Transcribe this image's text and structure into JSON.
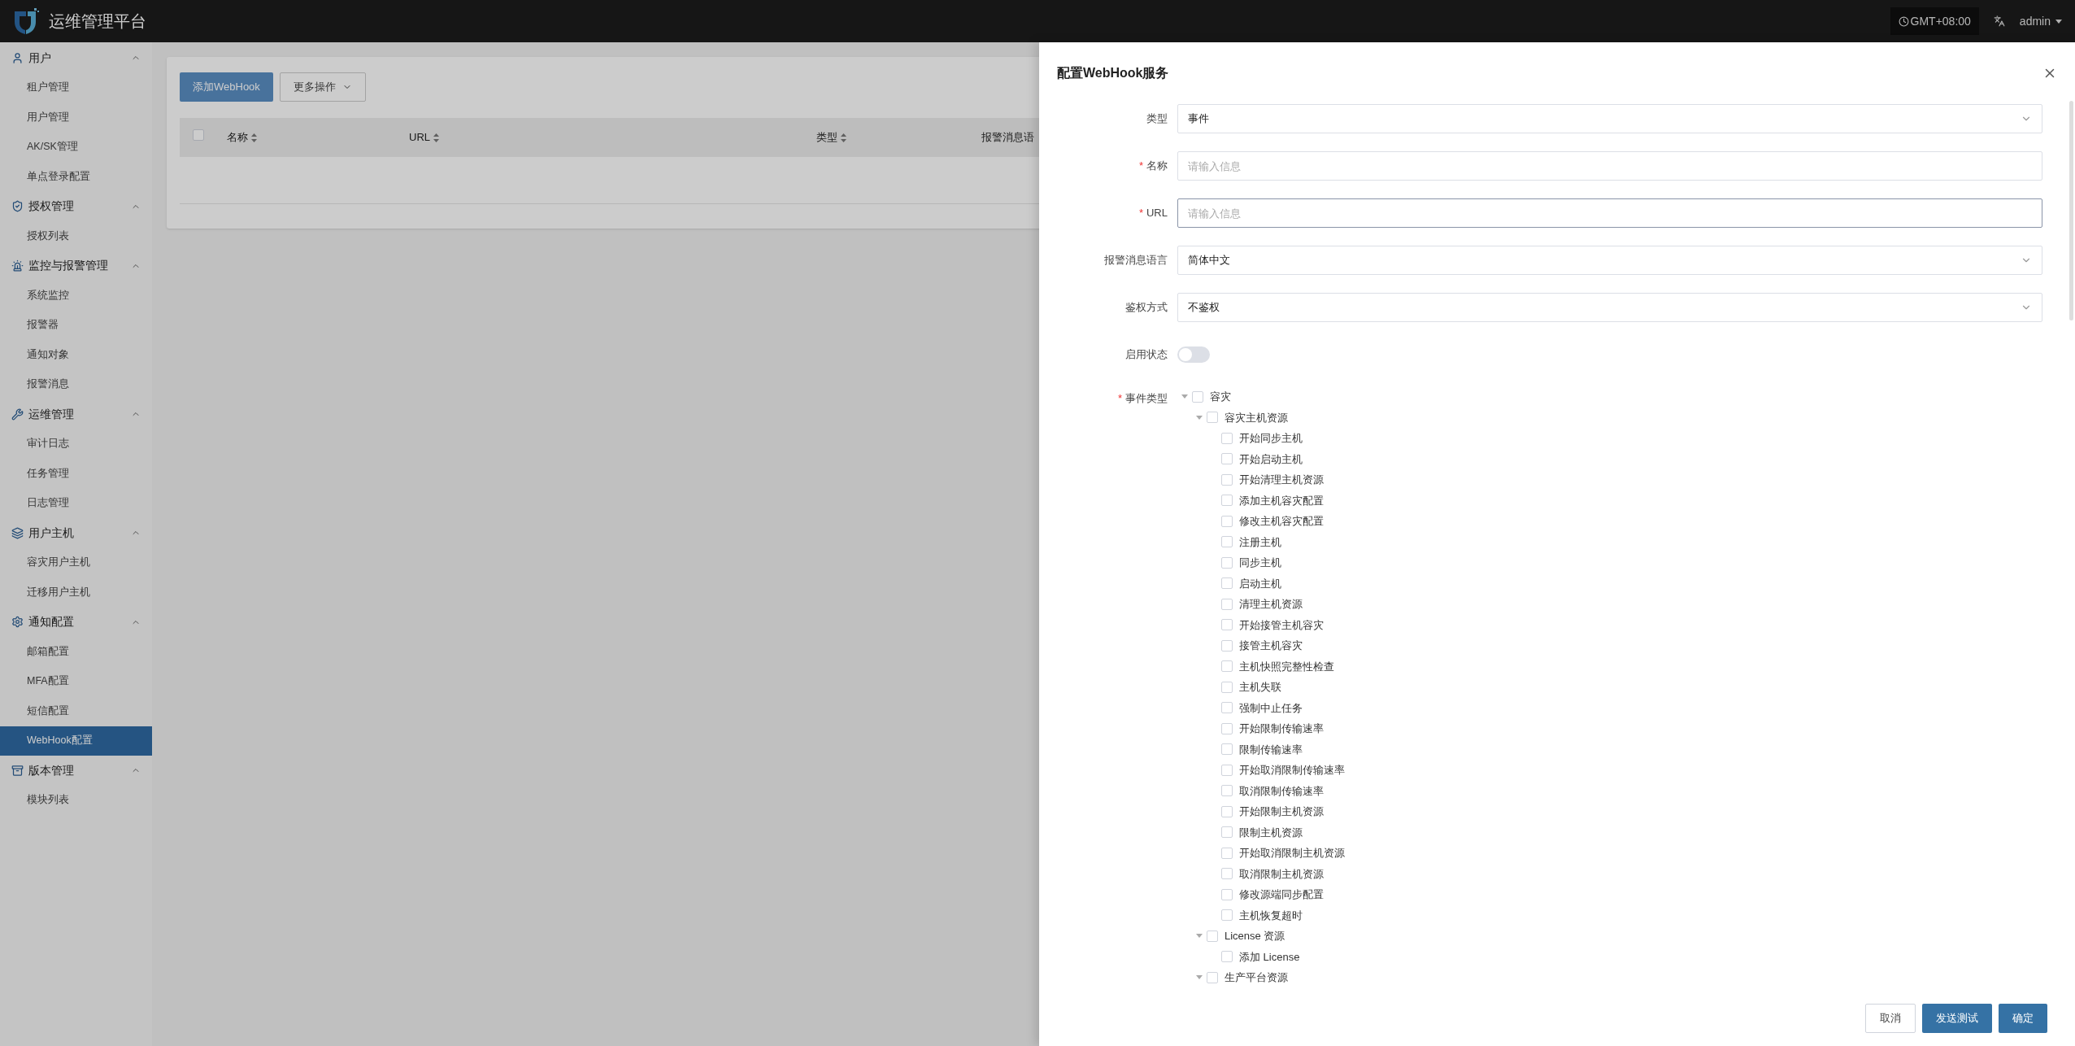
{
  "header": {
    "title": "运维管理平台",
    "timezone": "GMT+08:00",
    "user": "admin"
  },
  "sidebar": {
    "groups": [
      {
        "kind": "user",
        "label": "用户",
        "expanded": true,
        "items": [
          {
            "label": "租户管理",
            "selected": false
          },
          {
            "label": "用户管理",
            "selected": false
          },
          {
            "label": "AK/SK管理",
            "selected": false
          },
          {
            "label": "单点登录配置",
            "selected": false
          }
        ]
      },
      {
        "kind": "auth",
        "label": "授权管理",
        "expanded": true,
        "items": [
          {
            "label": "授权列表",
            "selected": false
          }
        ]
      },
      {
        "kind": "alarm",
        "label": "监控与报警管理",
        "expanded": true,
        "items": [
          {
            "label": "系统监控",
            "selected": false
          },
          {
            "label": "报警器",
            "selected": false
          },
          {
            "label": "通知对象",
            "selected": false
          },
          {
            "label": "报警消息",
            "selected": false
          }
        ]
      },
      {
        "kind": "ops",
        "label": "运维管理",
        "expanded": true,
        "items": [
          {
            "label": "审计日志",
            "selected": false
          },
          {
            "label": "任务管理",
            "selected": false
          },
          {
            "label": "日志管理",
            "selected": false
          }
        ]
      },
      {
        "kind": "host",
        "label": "用户主机",
        "expanded": true,
        "items": [
          {
            "label": "容灾用户主机",
            "selected": false
          },
          {
            "label": "迁移用户主机",
            "selected": false
          }
        ]
      },
      {
        "kind": "notify",
        "label": "通知配置",
        "expanded": true,
        "items": [
          {
            "label": "邮箱配置",
            "selected": false
          },
          {
            "label": "MFA配置",
            "selected": false
          },
          {
            "label": "短信配置",
            "selected": false
          },
          {
            "label": "WebHook配置",
            "selected": true
          }
        ]
      },
      {
        "kind": "version",
        "label": "版本管理",
        "expanded": true,
        "items": [
          {
            "label": "模块列表",
            "selected": false
          }
        ]
      }
    ]
  },
  "toolbar": {
    "add_button": "添加WebHook",
    "more_button": "更多操作"
  },
  "table": {
    "select_all_checked": false,
    "columns": [
      "名称",
      "URL",
      "类型",
      "报警消息语"
    ]
  },
  "drawer": {
    "title": "配置WebHook服务",
    "fields": [
      {
        "kind": "select",
        "label": "类型",
        "required": false,
        "value": "事件"
      },
      {
        "kind": "input",
        "label": "名称",
        "required": true,
        "placeholder": "请输入信息",
        "focused": false
      },
      {
        "kind": "input",
        "label": "URL",
        "required": true,
        "placeholder": "请输入信息",
        "focused": true
      },
      {
        "kind": "select",
        "label": "报警消息语言",
        "required": false,
        "value": "简体中文"
      },
      {
        "kind": "select",
        "label": "鉴权方式",
        "required": false,
        "value": "不鉴权"
      },
      {
        "kind": "switch",
        "label": "启用状态",
        "required": false,
        "on": false
      },
      {
        "kind": "tree",
        "label": "事件类型",
        "required": true
      }
    ],
    "event_tree": [
      {
        "label": "容灾",
        "checked": false,
        "expanded": true,
        "children": [
          {
            "label": "容灾主机资源",
            "checked": false,
            "expanded": true,
            "children": [
              {
                "label": "开始同步主机",
                "checked": false
              },
              {
                "label": "开始启动主机",
                "checked": false
              },
              {
                "label": "开始清理主机资源",
                "checked": false
              },
              {
                "label": "添加主机容灾配置",
                "checked": false
              },
              {
                "label": "修改主机容灾配置",
                "checked": false
              },
              {
                "label": "注册主机",
                "checked": false
              },
              {
                "label": "同步主机",
                "checked": false
              },
              {
                "label": "启动主机",
                "checked": false
              },
              {
                "label": "清理主机资源",
                "checked": false
              },
              {
                "label": "开始接管主机容灾",
                "checked": false
              },
              {
                "label": "接管主机容灾",
                "checked": false
              },
              {
                "label": "主机快照完整性检查",
                "checked": false
              },
              {
                "label": "主机失联",
                "checked": false
              },
              {
                "label": "强制中止任务",
                "checked": false
              },
              {
                "label": "开始限制传输速率",
                "checked": false
              },
              {
                "label": "限制传输速率",
                "checked": false
              },
              {
                "label": "开始取消限制传输速率",
                "checked": false
              },
              {
                "label": "取消限制传输速率",
                "checked": false
              },
              {
                "label": "开始限制主机资源",
                "checked": false
              },
              {
                "label": "限制主机资源",
                "checked": false
              },
              {
                "label": "开始取消限制主机资源",
                "checked": false
              },
              {
                "label": "取消限制主机资源",
                "checked": false
              },
              {
                "label": "修改源端同步配置",
                "checked": false
              },
              {
                "label": "主机恢复超时",
                "checked": false
              }
            ]
          },
          {
            "label": "License 资源",
            "checked": false,
            "expanded": true,
            "children": [
              {
                "label": "添加 License",
                "checked": false
              }
            ]
          },
          {
            "label": "生产平台资源",
            "checked": false,
            "expanded": true
          }
        ]
      }
    ],
    "required_mark": "*",
    "buttons": [
      {
        "kind": "default",
        "label": "取消"
      },
      {
        "kind": "primary",
        "label": "发送测试"
      },
      {
        "kind": "primary",
        "label": "确定"
      }
    ]
  }
}
